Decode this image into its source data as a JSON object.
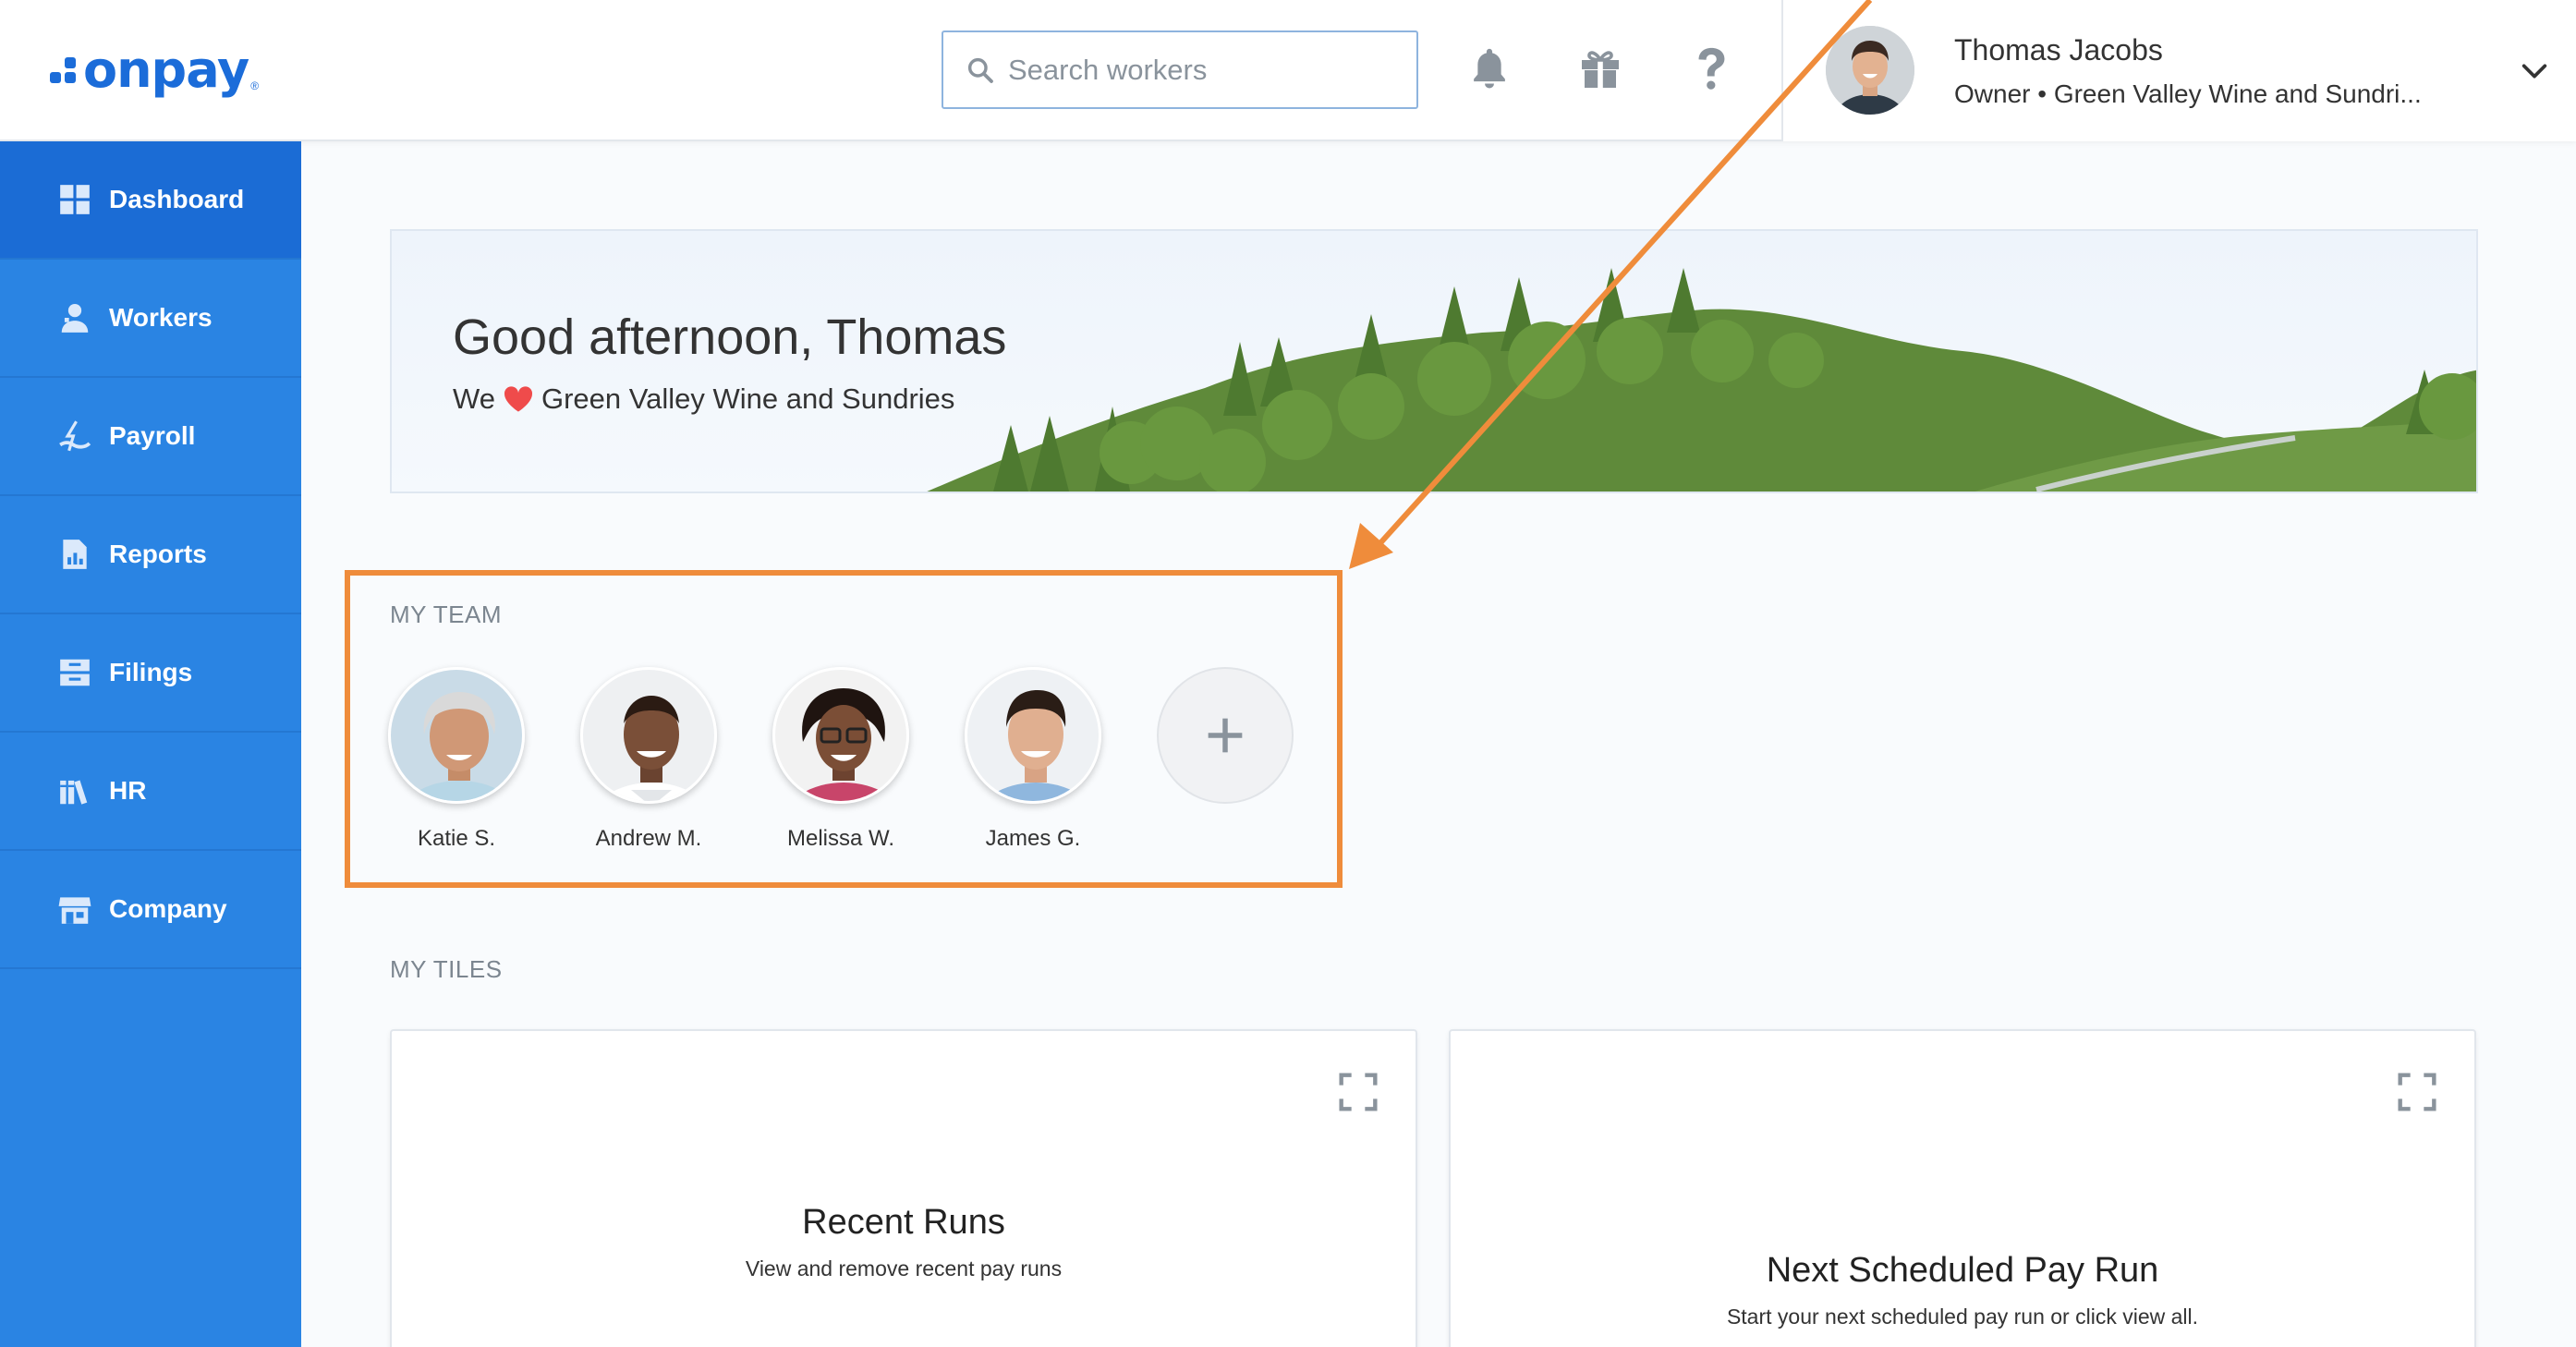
{
  "header": {
    "logo_text": "onpay",
    "logo_mark": "®",
    "search_placeholder": "Search workers",
    "icons": [
      "bell-icon",
      "gift-icon",
      "help-icon"
    ],
    "user": {
      "name": "Thomas Jacobs",
      "subtitle": "Owner • Green Valley Wine and Sundri..."
    }
  },
  "sidebar": {
    "items": [
      {
        "label": "Dashboard",
        "icon": "dashboard-icon",
        "active": true
      },
      {
        "label": "Workers",
        "icon": "workers-icon",
        "active": false
      },
      {
        "label": "Payroll",
        "icon": "payroll-icon",
        "active": false
      },
      {
        "label": "Reports",
        "icon": "reports-icon",
        "active": false
      },
      {
        "label": "Filings",
        "icon": "filings-icon",
        "active": false
      },
      {
        "label": "HR",
        "icon": "hr-icon",
        "active": false
      },
      {
        "label": "Company",
        "icon": "company-icon",
        "active": false
      }
    ]
  },
  "banner": {
    "greeting": "Good afternoon, Thomas",
    "sub_prefix": "We",
    "sub_company": "Green Valley Wine and Sundries"
  },
  "team": {
    "label": "MY TEAM",
    "members": [
      {
        "name": "Katie S."
      },
      {
        "name": "Andrew M."
      },
      {
        "name": "Melissa W."
      },
      {
        "name": "James G."
      }
    ],
    "add_icon": "plus-icon"
  },
  "tiles": {
    "label": "MY TILES",
    "items": [
      {
        "title": "Recent Runs",
        "subtitle": "View and remove recent pay runs"
      },
      {
        "title": "Next Scheduled Pay Run",
        "subtitle": "Start your next scheduled pay run or click view all."
      }
    ]
  },
  "colors": {
    "brand": "#1b6cd9",
    "sidebar": "#2a84e3",
    "sidebar_active": "#1b6cd5",
    "highlight": "#ef8c3b",
    "heart": "#ef4b4b",
    "hills": "#5f8a3a"
  }
}
